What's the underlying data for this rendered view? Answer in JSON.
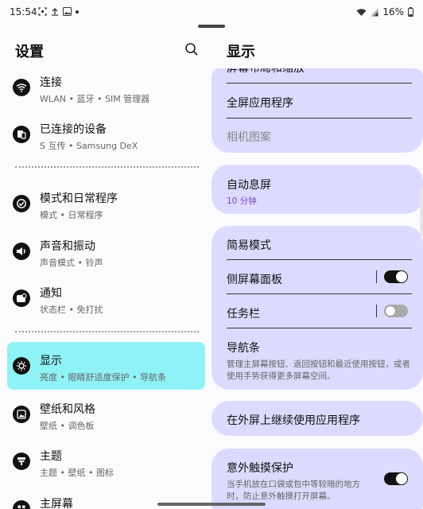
{
  "status_bar": {
    "time": "15:54",
    "battery": "16%",
    "left_icons": [
      "screenshot-icon",
      "upload-icon",
      "image-icon",
      "dot-icon"
    ],
    "right_icons": [
      "wifi-icon",
      "signal-icon",
      "battery-icon"
    ]
  },
  "left_pane": {
    "title": "设置",
    "items": [
      {
        "title": "连接",
        "subtitle": "WLAN • 蓝牙 • SIM 管理器",
        "icon": "wifi-icon"
      },
      {
        "title": "已连接的设备",
        "subtitle": "S 互传 • Samsung DeX",
        "icon": "devices-icon"
      },
      {
        "title": "模式和日常程序",
        "subtitle": "模式 • 日常程序",
        "icon": "check-circle-icon"
      },
      {
        "title": "声音和振动",
        "subtitle": "声音模式 • 铃声",
        "icon": "volume-icon"
      },
      {
        "title": "通知",
        "subtitle": "状态栏 • 免打扰",
        "icon": "notification-icon"
      },
      {
        "title": "显示",
        "subtitle": "亮度 • 眼睛舒适度保护 • 导航条",
        "icon": "brightness-icon",
        "active": true
      },
      {
        "title": "壁纸和风格",
        "subtitle": "壁纸 • 调色板",
        "icon": "wallpaper-icon"
      },
      {
        "title": "主题",
        "subtitle": "主题 • 壁纸 • 图标",
        "icon": "theme-icon"
      },
      {
        "title": "主屏幕",
        "subtitle": "",
        "icon": "home-icon"
      }
    ]
  },
  "right_pane": {
    "title": "显示",
    "card1": {
      "partial_item": "屏幕布局和缩放",
      "item_fullscreen": "全屏应用程序",
      "item_camera": "相机图案"
    },
    "card2": {
      "title": "自动息屏",
      "value": "10 分钟"
    },
    "card3": {
      "easy_mode": "简易模式",
      "edge_panels": "侧屏幕面板",
      "edge_panels_on": true,
      "taskbar": "任务栏",
      "taskbar_on": false,
      "nav_bar": "导航条",
      "nav_bar_desc": "管理主屏幕按钮、返回按钮和最近使用按钮，或者使用手势获得更多屏幕空间。"
    },
    "card4": {
      "title": "在外屏上继续使用应用程序"
    },
    "card5": {
      "title": "意外触摸保护",
      "desc": "当手机放在口袋或包中等较暗的地方时，防止意外触摸打开屏幕。",
      "on": true
    }
  },
  "colors": {
    "active_item_bg": "#8ff2f6",
    "card_bg": "#dcdbff",
    "accent_text": "#7a3fc4"
  }
}
